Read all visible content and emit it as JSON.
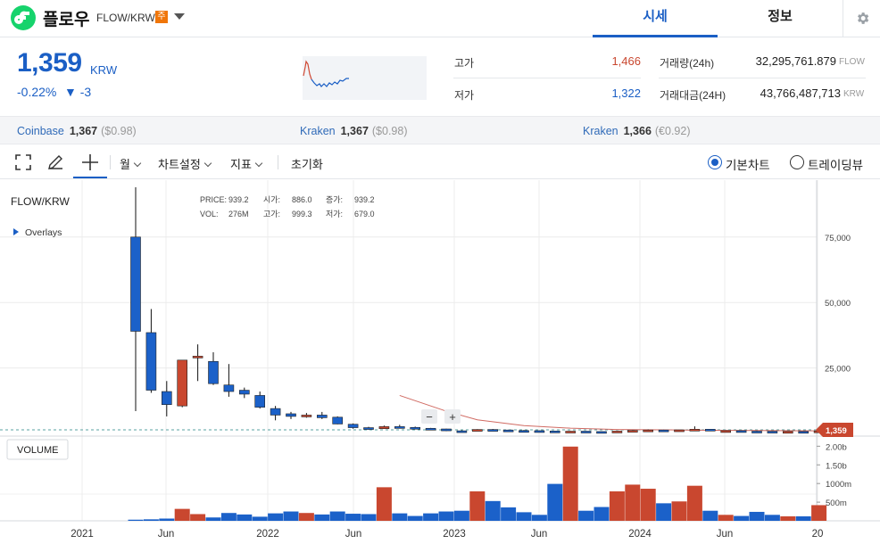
{
  "header": {
    "coin_name": "플로우",
    "pair": "FLOW/KRW",
    "caution_badge": "주",
    "tabs": [
      {
        "label": "시세",
        "active": true
      },
      {
        "label": "정보",
        "active": false
      }
    ]
  },
  "summary": {
    "price": "1,359",
    "unit": "KRW",
    "change_rate": "-0.22%",
    "change_amount": "▼ -3",
    "high_label": "고가",
    "high_value": "1,466",
    "low_label": "저가",
    "low_value": "1,322",
    "volume_label": "거래량(24h)",
    "volume_value": "32,295,761.879",
    "volume_unit": "FLOW",
    "amount_label": "거래대금(24H)",
    "amount_value": "43,766,487,713",
    "amount_unit": "KRW"
  },
  "exchanges": [
    {
      "name": "Coinbase",
      "price": "1,367",
      "foreign": "($0.98)"
    },
    {
      "name": "Kraken",
      "price": "1,367",
      "foreign": "($0.98)"
    },
    {
      "name": "Kraken",
      "price": "1,366",
      "foreign": "(€0.92)"
    }
  ],
  "toolbar": {
    "interval": "월",
    "chart_settings": "차트설정",
    "indicator": "지표",
    "reset": "초기화",
    "radio_basic": "기본차트",
    "radio_tv": "트레이딩뷰",
    "selected": "기본차트"
  },
  "colors": {
    "up": "#c9472f",
    "down": "#1b61c9",
    "accent": "#1b5fc5",
    "flow_green": "#16d36c"
  },
  "chart": {
    "symbol": "FLOW/KRW",
    "overlays": "Overlays",
    "ohlc_labels": {
      "price": "PRICE:",
      "open": "시가:",
      "change": "증가:",
      "vol": "VOL:",
      "high": "고가:",
      "low": "저가:"
    },
    "ohlc_values": {
      "price": "939.2",
      "open": "886.0",
      "change": "939.2",
      "vol": "276M",
      "high": "999.3",
      "low": "679.0"
    },
    "volume_label": "VOLUME",
    "current_price_tag": "1,359",
    "zoom_out": "−",
    "zoom_in": "+"
  },
  "chart_data": {
    "type": "candlestick",
    "interval": "monthly",
    "x_tick_labels": [
      "2021",
      "Jun",
      "2022",
      "Jun",
      "2023",
      "Jun",
      "2024",
      "Jun",
      "20"
    ],
    "y_tick_labels": [
      "75,000",
      "50,000",
      "25,000"
    ],
    "ylim": [
      0,
      94000
    ],
    "volume_tick_labels": [
      "2.00b",
      "1.50b",
      "1000m",
      "500m"
    ],
    "volume_ylim": [
      0,
      2200000000
    ],
    "candles": [
      {
        "t": "2021-03",
        "o": 75000,
        "h": 94000,
        "l": 8500,
        "c": 39000
      },
      {
        "t": "2021-04",
        "o": 38500,
        "h": 47500,
        "l": 15500,
        "c": 16500
      },
      {
        "t": "2021-05",
        "o": 16000,
        "h": 20000,
        "l": 6500,
        "c": 11000
      },
      {
        "t": "2021-06",
        "o": 10500,
        "h": 28000,
        "l": 10000,
        "c": 28000
      },
      {
        "t": "2021-07",
        "o": 29000,
        "h": 34000,
        "l": 20000,
        "c": 29500
      },
      {
        "t": "2021-08",
        "o": 27500,
        "h": 31000,
        "l": 18500,
        "c": 19000
      },
      {
        "t": "2021-09",
        "o": 18500,
        "h": 26500,
        "l": 14000,
        "c": 16000
      },
      {
        "t": "2021-10",
        "o": 16500,
        "h": 17500,
        "l": 13500,
        "c": 15000
      },
      {
        "t": "2021-11",
        "o": 14500,
        "h": 16000,
        "l": 9500,
        "c": 10000
      },
      {
        "t": "2021-12",
        "o": 9500,
        "h": 10500,
        "l": 5000,
        "c": 7000
      },
      {
        "t": "2022-01",
        "o": 7500,
        "h": 8200,
        "l": 5500,
        "c": 6500
      },
      {
        "t": "2022-02",
        "o": 6500,
        "h": 7800,
        "l": 6000,
        "c": 7000
      },
      {
        "t": "2022-03",
        "o": 7000,
        "h": 8200,
        "l": 5500,
        "c": 6000
      },
      {
        "t": "2022-04",
        "o": 6200,
        "h": 6500,
        "l": 3500,
        "c": 3600
      },
      {
        "t": "2022-05",
        "o": 3500,
        "h": 3800,
        "l": 1800,
        "c": 2200
      },
      {
        "t": "2022-06",
        "o": 2200,
        "h": 2500,
        "l": 1500,
        "c": 1800
      },
      {
        "t": "2022-07",
        "o": 1800,
        "h": 3000,
        "l": 1700,
        "c": 2600
      },
      {
        "t": "2022-08",
        "o": 2600,
        "h": 3300,
        "l": 2200,
        "c": 2300
      },
      {
        "t": "2022-09",
        "o": 2300,
        "h": 2600,
        "l": 1900,
        "c": 1950
      },
      {
        "t": "2022-10",
        "o": 1950,
        "h": 2100,
        "l": 1600,
        "c": 1700
      },
      {
        "t": "2022-11",
        "o": 1700,
        "h": 1800,
        "l": 900,
        "c": 1000
      },
      {
        "t": "2022-12",
        "o": 1000,
        "h": 1200,
        "l": 800,
        "c": 900
      },
      {
        "t": "2023-01",
        "o": 900,
        "h": 1600,
        "l": 850,
        "c": 1500
      },
      {
        "t": "2023-02",
        "o": 1500,
        "h": 1700,
        "l": 1200,
        "c": 1300
      },
      {
        "t": "2023-03",
        "o": 1300,
        "h": 1400,
        "l": 1000,
        "c": 1100
      },
      {
        "t": "2023-04",
        "o": 1100,
        "h": 1300,
        "l": 1000,
        "c": 1050
      },
      {
        "t": "2023-05",
        "o": 1050,
        "h": 1100,
        "l": 900,
        "c": 920
      },
      {
        "t": "2023-06",
        "o": 920,
        "h": 950,
        "l": 620,
        "c": 700
      },
      {
        "t": "2023-07",
        "o": 700,
        "h": 900,
        "l": 680,
        "c": 850
      },
      {
        "t": "2023-08",
        "o": 850,
        "h": 880,
        "l": 700,
        "c": 720
      },
      {
        "t": "2023-09",
        "o": 720,
        "h": 780,
        "l": 650,
        "c": 700
      },
      {
        "t": "2023-10",
        "o": 700,
        "h": 900,
        "l": 680,
        "c": 880
      },
      {
        "t": "2023-11",
        "o": 880,
        "h": 1200,
        "l": 850,
        "c": 1150
      },
      {
        "t": "2023-12",
        "o": 1150,
        "h": 1500,
        "l": 1000,
        "c": 1300
      },
      {
        "t": "2024-01",
        "o": 1300,
        "h": 1400,
        "l": 1000,
        "c": 1100
      },
      {
        "t": "2024-02",
        "o": 1100,
        "h": 1400,
        "l": 1050,
        "c": 1350
      },
      {
        "t": "2024-03",
        "o": 1350,
        "h": 2700,
        "l": 1300,
        "c": 1600
      },
      {
        "t": "2024-04",
        "o": 1600,
        "h": 1650,
        "l": 900,
        "c": 1000
      },
      {
        "t": "2024-05",
        "o": 1000,
        "h": 1150,
        "l": 950,
        "c": 1050
      },
      {
        "t": "2024-06",
        "o": 1050,
        "h": 1100,
        "l": 820,
        "c": 850
      },
      {
        "t": "2024-07",
        "o": 850,
        "h": 1000,
        "l": 780,
        "c": 820
      },
      {
        "t": "2024-08",
        "o": 820,
        "h": 850,
        "l": 650,
        "c": 700
      },
      {
        "t": "2024-09",
        "o": 700,
        "h": 800,
        "l": 690,
        "c": 760
      },
      {
        "t": "2024-10",
        "o": 760,
        "h": 790,
        "l": 650,
        "c": 700
      },
      {
        "t": "2024-11",
        "o": 886,
        "h": 999,
        "l": 679,
        "c": 939
      }
    ],
    "volumes": [
      30000000,
      40000000,
      60000000,
      320000000,
      180000000,
      90000000,
      210000000,
      170000000,
      110000000,
      200000000,
      250000000,
      210000000,
      170000000,
      250000000,
      190000000,
      180000000,
      900000000,
      200000000,
      130000000,
      200000000,
      250000000,
      270000000,
      790000000,
      530000000,
      360000000,
      230000000,
      160000000,
      990000000,
      1990000000,
      270000000,
      370000000,
      790000000,
      970000000,
      860000000,
      470000000,
      520000000,
      940000000,
      270000000,
      160000000,
      130000000,
      240000000,
      160000000,
      120000000,
      120000000,
      420000000
    ],
    "ma_line": [
      [
        17,
        14500
      ],
      [
        20,
        8500
      ],
      [
        22,
        5200
      ],
      [
        25,
        3000
      ],
      [
        28,
        2000
      ],
      [
        31,
        1500
      ],
      [
        35,
        1300
      ],
      [
        40,
        1100
      ],
      [
        44,
        1000
      ]
    ]
  }
}
